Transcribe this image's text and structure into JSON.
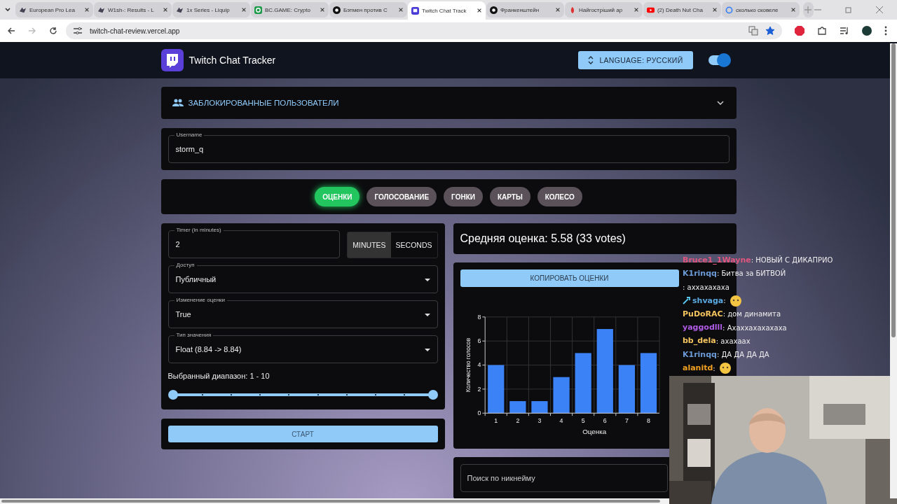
{
  "browser": {
    "tabs": [
      {
        "title": "European Pro Lea",
        "selected": false,
        "kind": "logo"
      },
      {
        "title": "W1sh-: Results - L",
        "selected": false,
        "kind": "logo"
      },
      {
        "title": "1x Series - Liquip",
        "selected": false,
        "kind": "logo"
      },
      {
        "title": "BC.GAME: Crypto",
        "selected": false,
        "kind": "green"
      },
      {
        "title": "Бэтмен против С",
        "selected": false,
        "kind": "dark"
      },
      {
        "title": "Twitch Chat Track",
        "selected": true,
        "kind": "twitch"
      },
      {
        "title": "Франкенштейн",
        "selected": false,
        "kind": "dark"
      },
      {
        "title": "Найгостріший ар",
        "selected": false,
        "kind": "pepper"
      },
      {
        "title": "(2) Death Nut Cha",
        "selected": false,
        "kind": "video"
      },
      {
        "title": "сколько сковеле",
        "selected": false,
        "kind": "search"
      }
    ],
    "url": "twitch-chat-review.vercel.app",
    "bookmarked": true
  },
  "app": {
    "title": "Twitch Chat Tracker",
    "language_button": "LANGUAGE: РУССКИЙ",
    "dark_mode": {
      "on": true
    }
  },
  "blocked_users": {
    "label": "ЗАБЛОКИРОВАННЫЕ ПОЛЬЗОВАТЕЛИ",
    "expanded": false
  },
  "username": {
    "label": "Username",
    "value": "storm_q"
  },
  "modes": [
    {
      "label": "ОЦЕНКИ",
      "selected": true
    },
    {
      "label": "ГОЛОСОВАНИЕ",
      "selected": false
    },
    {
      "label": "ГОНКИ",
      "selected": false
    },
    {
      "label": "КАРТЫ",
      "selected": false
    },
    {
      "label": "КОЛЕСО",
      "selected": false
    }
  ],
  "timer": {
    "label": "Timer (in minutes)",
    "value": "2"
  },
  "units": [
    {
      "label": "MINUTES",
      "selected": true
    },
    {
      "label": "SECONDS",
      "selected": false
    }
  ],
  "selects": [
    {
      "label": "Доступ",
      "value": "Публичный"
    },
    {
      "label": "Изменение оценки",
      "value": "True"
    },
    {
      "label": "Тип значения",
      "value": "Float (8.84 -> 8.84)"
    }
  ],
  "range": {
    "label": "Выбранный диапазон: 1 - 10",
    "level": 1
  },
  "start_button": "СТАРТ",
  "average": "Средняя оценка: 5.58 (33 votes)",
  "copy_button": "КОПИРОВАТЬ ОЦЕНКИ",
  "chart_data": {
    "type": "bar",
    "xlabel": "Оценка",
    "ylabel": "Количество голосов",
    "categories": [
      "1",
      "2",
      "3",
      "4",
      "5",
      "6",
      "7",
      "8"
    ],
    "values": [
      4,
      1,
      1,
      3,
      5,
      7,
      4,
      5
    ],
    "ylim": [
      0,
      8
    ],
    "yticks": [
      0,
      2,
      4,
      6,
      8
    ],
    "grid": true
  },
  "search": {
    "placeholder": "Поиск по никнейму"
  },
  "chat": [
    {
      "user": "Bruce1_1Wayne",
      "color": "#e0567e",
      "badge": false,
      "kind": "text",
      "text": ": НОВЫЙ С ДИКАПРИО"
    },
    {
      "user": "K1rinqq",
      "color": "#6b9ad6",
      "badge": false,
      "kind": "text",
      "text": ": Битва за БИТВОЙ"
    },
    {
      "badge": false,
      "kind": "text",
      "text": ": аххахахаха"
    },
    {
      "user": "shvaga",
      "color": "#5aa8e0",
      "badge": true,
      "kind": "emote",
      "text": ":"
    },
    {
      "user": "PuDoRAC",
      "color": "#f2c35e",
      "badge": false,
      "kind": "text",
      "text": ": дом динамита"
    },
    {
      "user": "yaggodlll",
      "color": "#b05ce6",
      "badge": false,
      "kind": "text",
      "text": ": Ахаххахахахаха"
    },
    {
      "user": "bb_dela",
      "color": "#f2c35e",
      "badge": false,
      "kind": "text",
      "text": ": ахахаах"
    },
    {
      "user": "K1rinqq",
      "color": "#6b9ad6",
      "badge": false,
      "kind": "text",
      "text": ": ДА ДА ДА ДА"
    },
    {
      "user": "alanitd",
      "color": "#f0a020",
      "badge": false,
      "kind": "emote",
      "text": ":"
    }
  ]
}
